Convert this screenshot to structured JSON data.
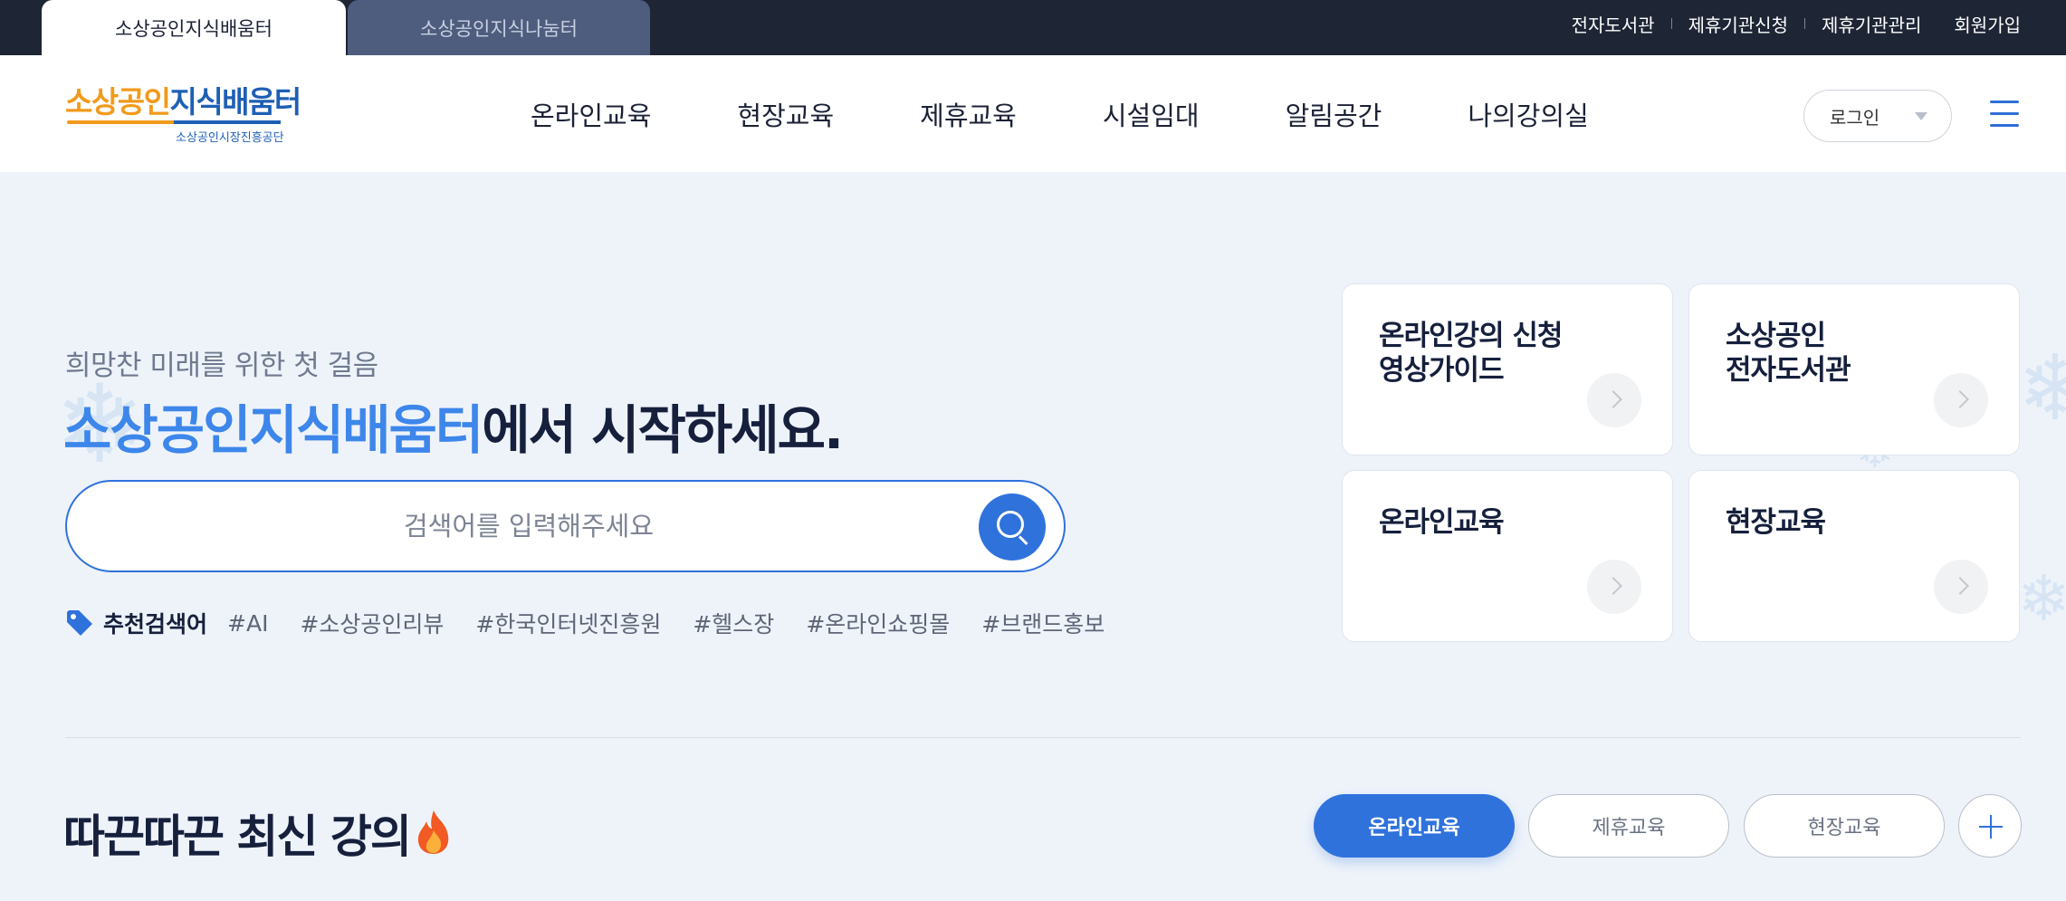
{
  "site_tabs": [
    {
      "label": "소상공인지식배움터",
      "active": true
    },
    {
      "label": "소상공인지식나눔터",
      "active": false
    }
  ],
  "util_links": [
    "전자도서관",
    "제휴기관신청",
    "제휴기관관리",
    "회원가입"
  ],
  "logo": {
    "part1": "소상공인",
    "part2": "지식배움터",
    "sub": "소상공인시장진흥공단"
  },
  "gnb": [
    "온라인교육",
    "현장교육",
    "제휴교육",
    "시설임대",
    "알림공간",
    "나의강의실"
  ],
  "login": {
    "label": "로그인"
  },
  "hero": {
    "subtitle": "희망찬 미래를 위한 첫 걸음",
    "title_accent": "소상공인지식배움터",
    "title_rest": "에서 시작하세요."
  },
  "search": {
    "placeholder": "검색어를 입력해주세요",
    "value": ""
  },
  "tags": {
    "heading": "추천검색어",
    "items": [
      "#AI",
      "#소상공인리뷰",
      "#한국인터넷진흥원",
      "#헬스장",
      "#온라인쇼핑몰",
      "#브랜드홍보"
    ]
  },
  "cards": [
    {
      "title": "온라인강의 신청\n영상가이드"
    },
    {
      "title": "소상공인\n전자도서관"
    },
    {
      "title": "온라인교육"
    },
    {
      "title": "현장교육"
    }
  ],
  "latest": {
    "title": "따끈따끈 최신 강의",
    "filters": [
      "온라인교육",
      "제휴교육",
      "현장교육"
    ],
    "active_filter": "온라인교육"
  },
  "colors": {
    "accent": "#2f72dc",
    "logo_orange": "#f29a1b",
    "logo_blue": "#1e5fb5",
    "topbar": "#1e2535"
  }
}
